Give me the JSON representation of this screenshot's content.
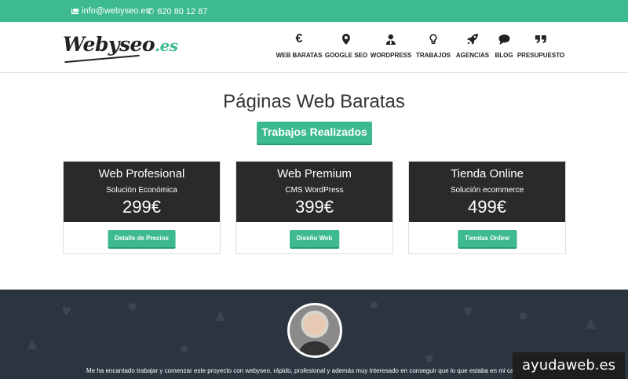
{
  "topbar": {
    "email": "info@webyseo.es",
    "phone": "620 80 12 87"
  },
  "logo": {
    "main": "Webyseo",
    "suffix": ".es"
  },
  "nav": [
    {
      "label": "WEB BARATAS",
      "icon": "euro-icon"
    },
    {
      "label": "GOOGLE SEO",
      "icon": "map-marker-icon"
    },
    {
      "label": "WORDPRESS",
      "icon": "user-tie-icon"
    },
    {
      "label": "TRABAJOS",
      "icon": "lightbulb-icon"
    },
    {
      "label": "AGENCIAS",
      "icon": "rocket-icon"
    },
    {
      "label": "BLOG",
      "icon": "comment-icon"
    },
    {
      "label": "PRESUPUESTO",
      "icon": "quote-icon"
    }
  ],
  "main": {
    "title": "Páginas Web Baratas",
    "cta": "Trabajos Realizados"
  },
  "cards": [
    {
      "name": "Web Profesional",
      "subtitle": "Solución Económica",
      "price": "299€",
      "button": "Detalle de Precios"
    },
    {
      "name": "Web Premium",
      "subtitle": "CMS WordPress",
      "price": "399€",
      "button": "Diseño Web"
    },
    {
      "name": "Tienda Online",
      "subtitle": "Solución ecommerce",
      "price": "499€",
      "button": "Tiendas Online"
    }
  ],
  "testimonial": {
    "text": "Me ha encantado trabajar y comenzar este proyecto con webyseo, rápido, profesional y además muy interesado en conseguir que lo que estaba en mi cabeza"
  },
  "watermark": "ayudaweb.es",
  "colors": {
    "accent": "#3dbb8e",
    "dark": "#2a2a2a",
    "footer": "#2c3440"
  }
}
